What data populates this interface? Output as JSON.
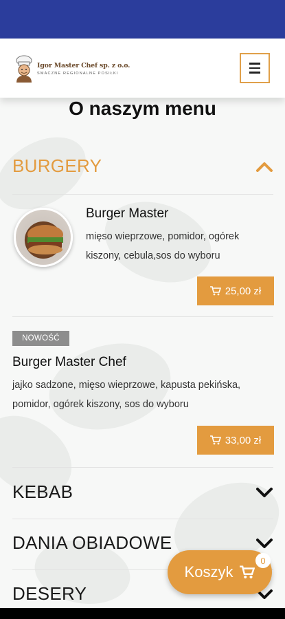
{
  "header": {
    "logo_name": "Igor Master Chef sp. z o.o.",
    "logo_tagline": "SMACZNE REGIONALNE POSIŁKI",
    "menu_icon": "hamburger-icon"
  },
  "page": {
    "title": "O naszym menu"
  },
  "sections": [
    {
      "title": "BURGERY",
      "expanded": true,
      "items": [
        {
          "name": "Burger Master",
          "description_line1": "mięso wieprzowe, pomidor, ogórek",
          "description_line2": "kiszony, cebula,sos do wyboru",
          "price": "25,00 zł"
        },
        {
          "badge": "NOWOŚĆ",
          "name": "Burger Master Chef",
          "description_line1": "jajko sadzone, mięso wieprzowe, kapusta pekińska,",
          "description_line2": "pomidor, ogórek kiszony, sos do wyboru",
          "price": "33,00 zł"
        }
      ]
    },
    {
      "title": "KEBAB",
      "expanded": false
    },
    {
      "title": "DANIA OBIADOWE",
      "expanded": false
    },
    {
      "title": "DESERY",
      "expanded": false
    }
  ],
  "cart": {
    "label": "Koszyk",
    "count": "0",
    "icon": "shopping-cart-icon"
  },
  "colors": {
    "accent": "#e39b3f",
    "status_bar": "#2b3d9c",
    "badge": "#8d8d8d"
  }
}
